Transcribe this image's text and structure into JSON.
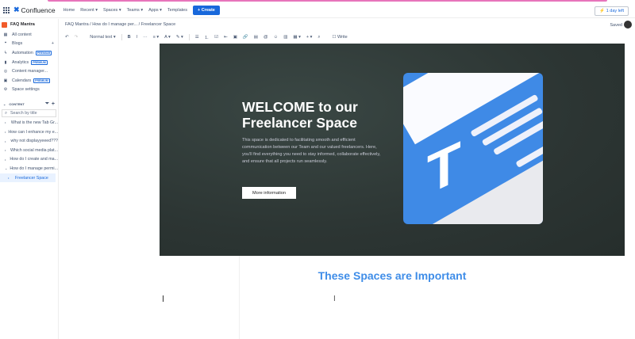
{
  "topnav": {
    "product": "Confluence",
    "items": [
      "Home",
      "Recent ▾",
      "Spaces ▾",
      "Teams ▾",
      "Apps ▾",
      "Templates"
    ],
    "create": "+ Create",
    "trial": "⚡ 1 day left"
  },
  "sidebar": {
    "space": "FAQ Mantra",
    "items": [
      {
        "icon": "▦",
        "label": "All content"
      },
      {
        "icon": "❝",
        "label": "Blogs",
        "add": "+"
      },
      {
        "icon": "ϟ",
        "label": "Automation",
        "badge": "PREMIUM"
      },
      {
        "icon": "▮",
        "label": "Analytics",
        "badge": "PREMIUM"
      },
      {
        "icon": "◎",
        "label": "Content manager..."
      },
      {
        "icon": "▣",
        "label": "Calendars",
        "badge": "PREMIUM"
      },
      {
        "icon": "⚙",
        "label": "Space settings"
      }
    ],
    "content_label": "CONTENT",
    "search_placeholder": "Search by title",
    "pages": [
      "What is the new Tab Gr...",
      "How can I enhance my e...",
      "why not displayyeeed???",
      "Which social media plat...",
      "How do I create and ma...",
      "How do I manage permi...",
      "Freelancer Space"
    ]
  },
  "breadcrumb": [
    "FAQ Mantra",
    "How do I manage per...",
    "Freelancer Space"
  ],
  "status": {
    "saved": "Saved"
  },
  "toolbar": {
    "undo": "↶",
    "redo": "↷",
    "style": "Normal text ▾",
    "bold": "B",
    "italic": "I",
    "more": "···",
    "align": "≡ ▾",
    "color": "A ▾",
    "highlight": "✎ ▾",
    "bullets": "☰",
    "numbered": "⒈",
    "task": "☑",
    "outdent": "⇤",
    "action": "▣",
    "link": "🔗",
    "image": "▤",
    "mention": "@",
    "emoji": "☺",
    "layout": "▥",
    "table": "▦ ▾",
    "insert": "+ ▾",
    "find": "⌕",
    "write": "☐ Write"
  },
  "hero": {
    "title": "WELCOME to our Freelancer Space",
    "description": "This space is dedicated to facilitating smooth and efficient communication between our Team and our valued freelancers. Here, you'll find everything you need to stay informed, collaborate effectively, and ensure that all projects run seamlessly.",
    "button": "More information",
    "art_letter": "T"
  },
  "section_title": "These Spaces are Important",
  "colors": {
    "accent": "#1868db",
    "heading": "#3f8de8",
    "hero_bg": "#2c3533"
  }
}
